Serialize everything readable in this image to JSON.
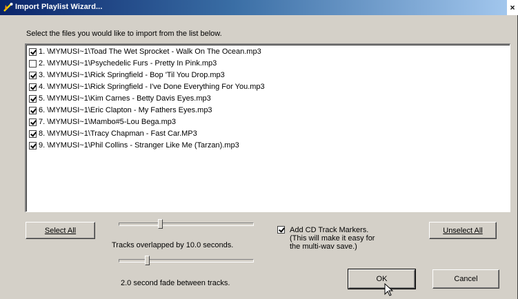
{
  "window": {
    "title": "Import Playlist Wizard...",
    "close_glyph": "×"
  },
  "instruction": "Select the files you would like to import from the list below.",
  "files": [
    {
      "label": "1.  \\MYMUSI~1\\Toad The Wet Sprocket - Walk On The Ocean.mp3",
      "checked": true
    },
    {
      "label": "2.  \\MYMUSI~1\\Psychedelic Furs - Pretty In Pink.mp3",
      "checked": false
    },
    {
      "label": "3.  \\MYMUSI~1\\Rick Springfield - Bop 'Til You Drop.mp3",
      "checked": true
    },
    {
      "label": "4.  \\MYMUSI~1\\Rick Springfield - I've Done Everything For You.mp3",
      "checked": true
    },
    {
      "label": "5.  \\MYMUSI~1\\Kim Carnes - Betty Davis Eyes.mp3",
      "checked": true
    },
    {
      "label": "6.  \\MYMUSI~1\\Eric Clapton - My Fathers Eyes.mp3",
      "checked": true
    },
    {
      "label": "7.  \\MYMUSI~1\\Mambo#5-Lou Bega.mp3",
      "checked": true
    },
    {
      "label": "8.  \\MYMUSI~1\\Tracy Chapman - Fast Car.MP3",
      "checked": true
    },
    {
      "label": "9.  \\MYMUSI~1\\Phil Collins - Stranger Like Me (Tarzan).mp3",
      "checked": true
    }
  ],
  "buttons": {
    "select_all": "Select All",
    "unselect_all": "Unselect All",
    "ok": "OK",
    "cancel": "Cancel"
  },
  "overlap": {
    "label": "Tracks overlapped by 10.0 seconds.",
    "slider_fraction": 0.3
  },
  "fade": {
    "label": "2.0 second fade between tracks.",
    "slider_fraction": 0.2
  },
  "cd_markers": {
    "checked": true,
    "line1": "Add CD Track Markers.",
    "line2": "(This will make it easy for",
    "line3": "the multi-wav save.)"
  },
  "colors": {
    "dialog_face": "#d4d0c8",
    "titlebar_start": "#0a246a",
    "titlebar_end": "#a6caf0"
  }
}
